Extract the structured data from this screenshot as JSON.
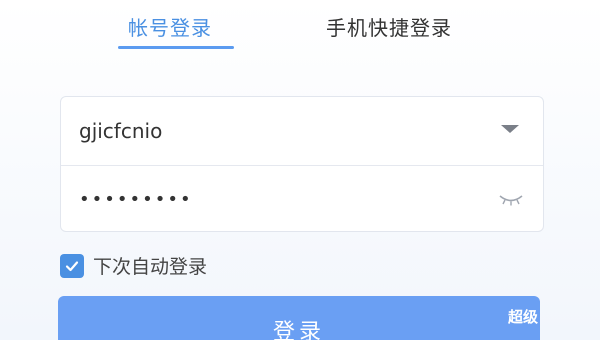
{
  "tabs": {
    "account_login": "帐号登录",
    "phone_login": "手机快捷登录"
  },
  "form": {
    "username_value": "gjicfcnio",
    "password_value": "•••••••••",
    "remember_label": "下次自动登录",
    "remember_checked": true,
    "login_label": "登录",
    "badge_label": "超级"
  },
  "icons": {
    "dropdown": "chevron-down-icon",
    "password_toggle": "eye-closed-icon",
    "checkbox": "check-icon"
  },
  "colors": {
    "accent": "#4a90e2",
    "button": "#6a9ff3",
    "text": "#333333"
  }
}
